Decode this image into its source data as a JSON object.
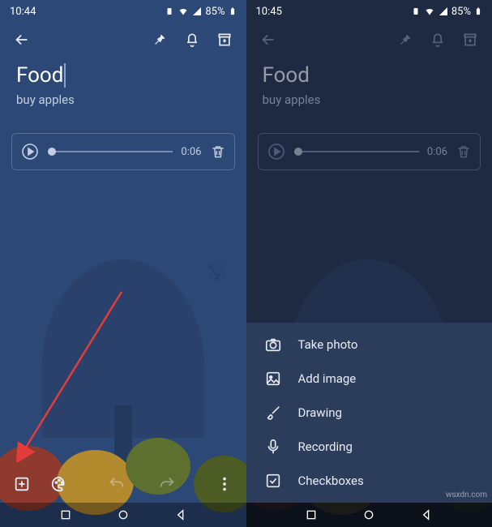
{
  "left": {
    "status": {
      "time": "10:44",
      "battery_pct": "85%"
    },
    "note": {
      "title": "Food",
      "body": "buy apples"
    },
    "player": {
      "duration": "0:06"
    }
  },
  "right": {
    "status": {
      "time": "10:45",
      "battery_pct": "85%"
    },
    "note": {
      "title": "Food",
      "body": "buy apples"
    },
    "player": {
      "duration": "0:06"
    },
    "menu": {
      "take_photo": "Take photo",
      "add_image": "Add image",
      "drawing": "Drawing",
      "recording": "Recording",
      "checkboxes": "Checkboxes"
    }
  },
  "watermark": "wsxdn.com"
}
